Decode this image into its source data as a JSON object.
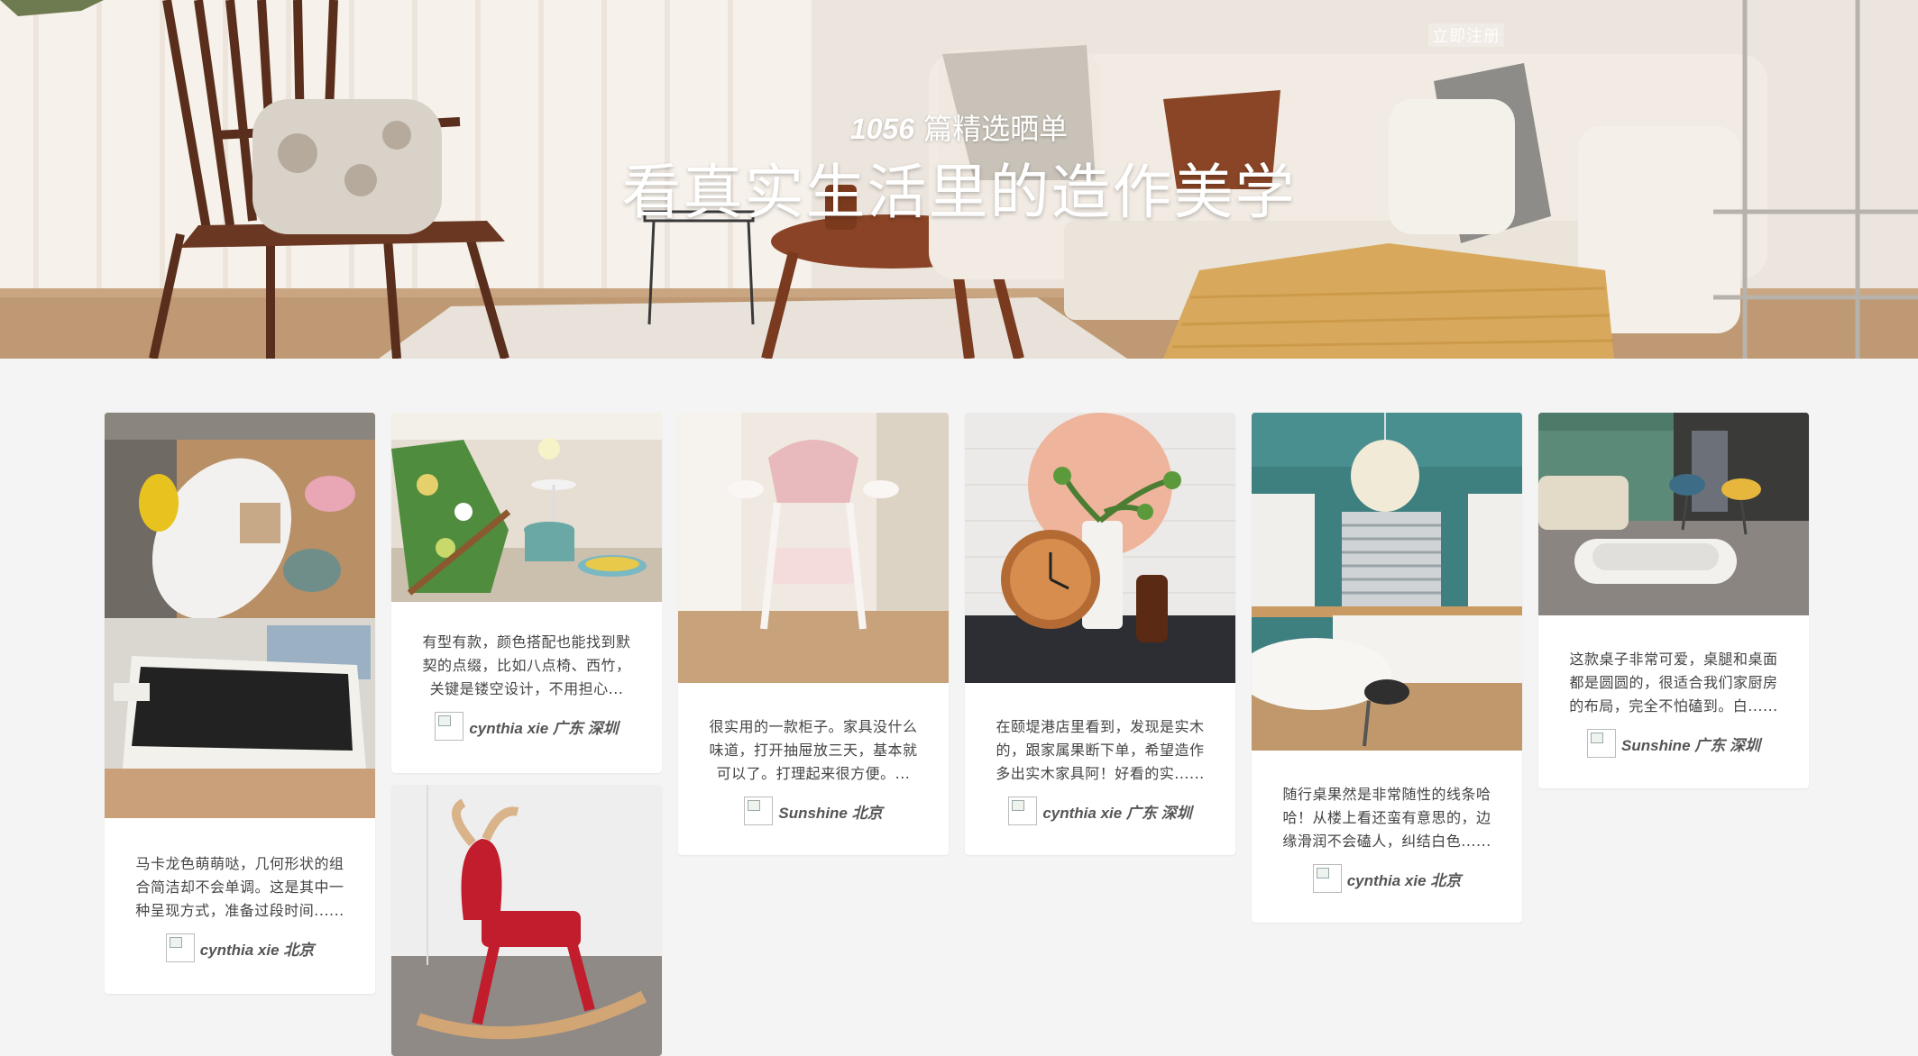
{
  "hero": {
    "top_link": "立即注册",
    "count_number": "1056",
    "count_suffix": " 篇精选晒单",
    "title": "看真实生活里的造作美学"
  },
  "cards": [
    {
      "desc": "马卡龙色萌萌哒，几何形状的组合简洁却不会单调。这是其中一种呈现方式，准备过段时间......",
      "author": "cynthia xie 北京"
    },
    {
      "desc": "有型有款，颜色搭配也能找到默契的点缀，比如八点椅、西竹，关键是镂空设计，不用担心...",
      "author": "cynthia xie 广东 深圳"
    },
    {
      "desc": "很实用的一款柜子。家具没什么味道，打开抽屉放三天，基本就可以了。打理起来很方便。...",
      "author": "Sunshine 北京"
    },
    {
      "desc": "在颐堤港店里看到，发现是实木的，跟家属果断下单，希望造作多出实木家具阿！好看的实......",
      "author": "cynthia xie 广东 深圳"
    },
    {
      "desc": "随行桌果然是非常随性的线条哈哈！从楼上看还蛮有意思的，边缘滑润不会磕人，纠结白色......",
      "author": "cynthia xie 北京"
    },
    {
      "desc": "这款桌子非常可爱，桌腿和桌面都是圆圆的，很适合我们家厨房的布局，完全不怕磕到。白......",
      "author": "Sunshine 广东 深圳"
    }
  ],
  "icons": [
    "avatar-placeholder-icon"
  ]
}
